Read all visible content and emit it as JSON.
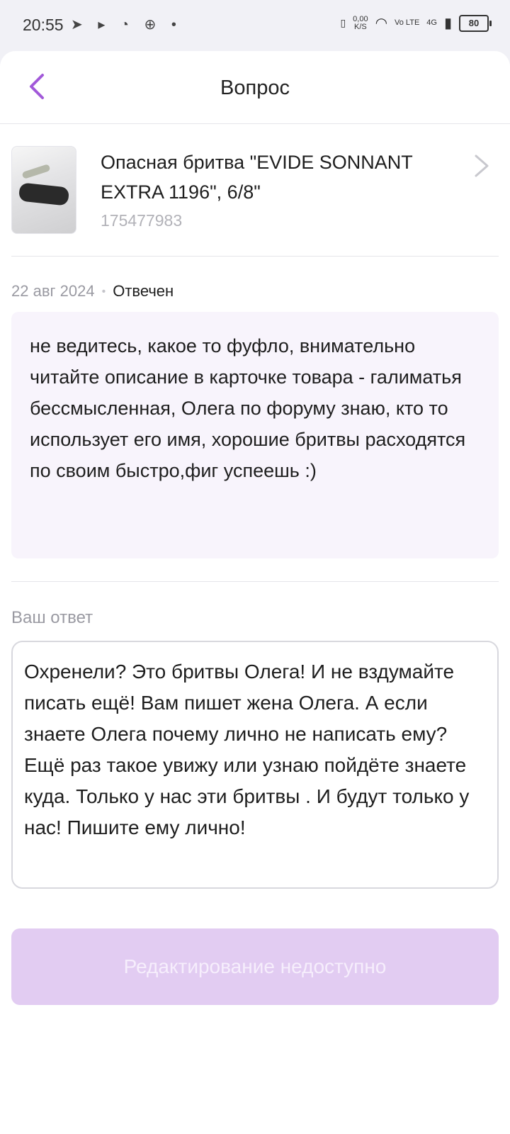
{
  "status_bar": {
    "time": "20:55",
    "net_speed_value": "0,00",
    "net_speed_unit": "K/S",
    "volte": "Vo LTE",
    "network": "4G",
    "battery": "80"
  },
  "header": {
    "title": "Вопрос"
  },
  "product": {
    "name": "Опасная бритва \"EVIDE SONNANT EXTRA 1196\", 6/8\"",
    "sku": "175477983"
  },
  "question": {
    "date": "22 авг 2024",
    "status": "Отвечен",
    "text": "не ведитесь, какое то фуфло, внимательно читайте описание в карточке товара - галиматья бессмысленная, Олега по форуму знаю, кто то использует его имя, хорошие бритвы расходятся по своим быстро,фиг успеешь :)"
  },
  "answer": {
    "label": "Ваш ответ",
    "value": "Охренели? Это бритвы Олега! И не вздумайте писать ещё! Вам пишет жена Олега. А если знаете Олега почему лично не написать ему? Ещё раз такое увижу или узнаю пойдёте знаете куда. Только у нас эти бритвы . И будут только у нас! Пишите ему лично!"
  },
  "edit_button": {
    "label": "Редактирование недоступно"
  },
  "colors": {
    "accent": "#a259d9",
    "button_disabled_bg": "#e2ccf2",
    "question_bg": "#f8f4fc"
  }
}
